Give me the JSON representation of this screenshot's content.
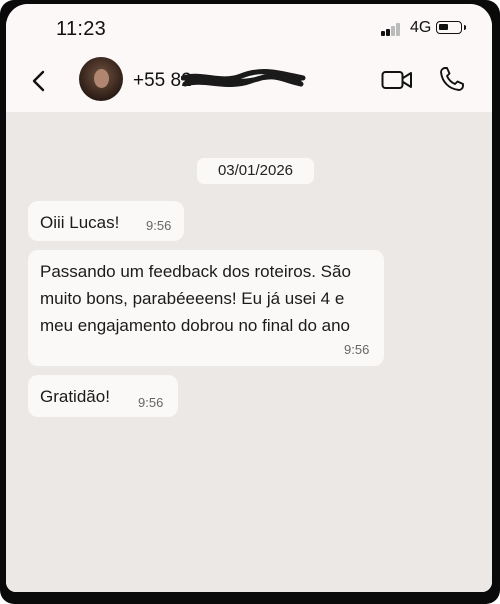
{
  "status_bar": {
    "time": "11:23",
    "network": "4G"
  },
  "contact": {
    "phone_visible": "+55 82"
  },
  "chat": {
    "date": "03/01/2026",
    "messages": [
      {
        "text": "Oiii Lucas!",
        "time": "9:56"
      },
      {
        "text": "Passando um feedback dos roteiros. São muito bons, parabéeeens! Eu já usei 4 e meu engajamento dobrou no final do ano",
        "time": "9:56"
      },
      {
        "text": "Gratidão!",
        "time": "9:56"
      }
    ]
  },
  "colors": {
    "chat_background": "#ece8e5",
    "bubble": "#fbf9f8",
    "header": "#fbf8f7",
    "frame": "#0a0a0a"
  }
}
